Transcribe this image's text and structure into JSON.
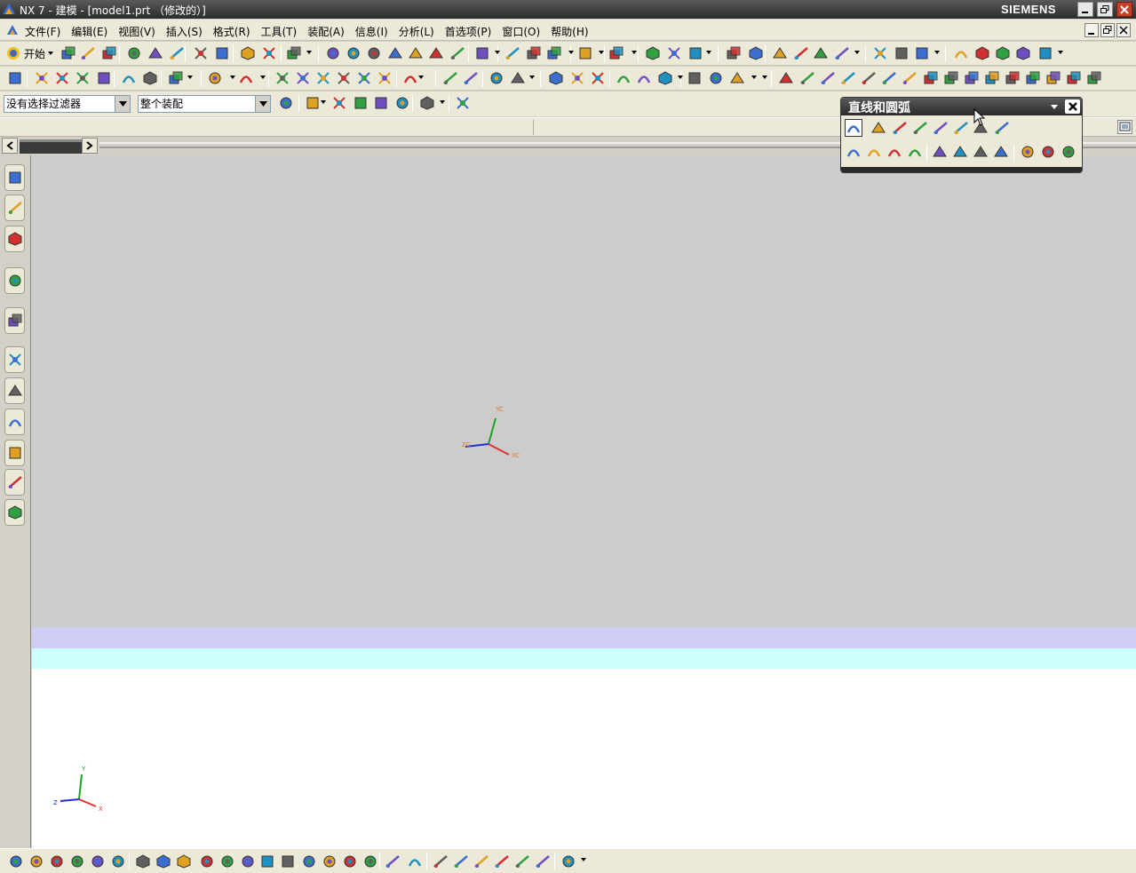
{
  "window": {
    "title": "NX 7 - 建模 - [model1.prt （修改的）]",
    "brand": "SIEMENS"
  },
  "menu": {
    "items": [
      "文件(F)",
      "编辑(E)",
      "视图(V)",
      "插入(S)",
      "格式(R)",
      "工具(T)",
      "装配(A)",
      "信息(I)",
      "分析(L)",
      "首选项(P)",
      "窗口(O)",
      "帮助(H)"
    ]
  },
  "toolbar": {
    "start_label": "开始"
  },
  "selection": {
    "filter_value": "没有选择过滤器",
    "scope_value": "整个装配"
  },
  "palette": {
    "title": "直线和圆弧"
  },
  "viewport": {
    "work_csys": {
      "x": "XC",
      "y": "YC",
      "z": "ZC"
    },
    "abs_csys": {
      "x": "X",
      "y": "Y",
      "z": "Z"
    }
  },
  "colors": {
    "band_lavender": "#cdcdf6",
    "band_cyan": "#ccfffe",
    "graphics_bg": "#cccccc",
    "axis_x": "#e03030",
    "axis_y": "#20a020",
    "axis_z": "#2030d0",
    "label_orange": "#e07820"
  }
}
